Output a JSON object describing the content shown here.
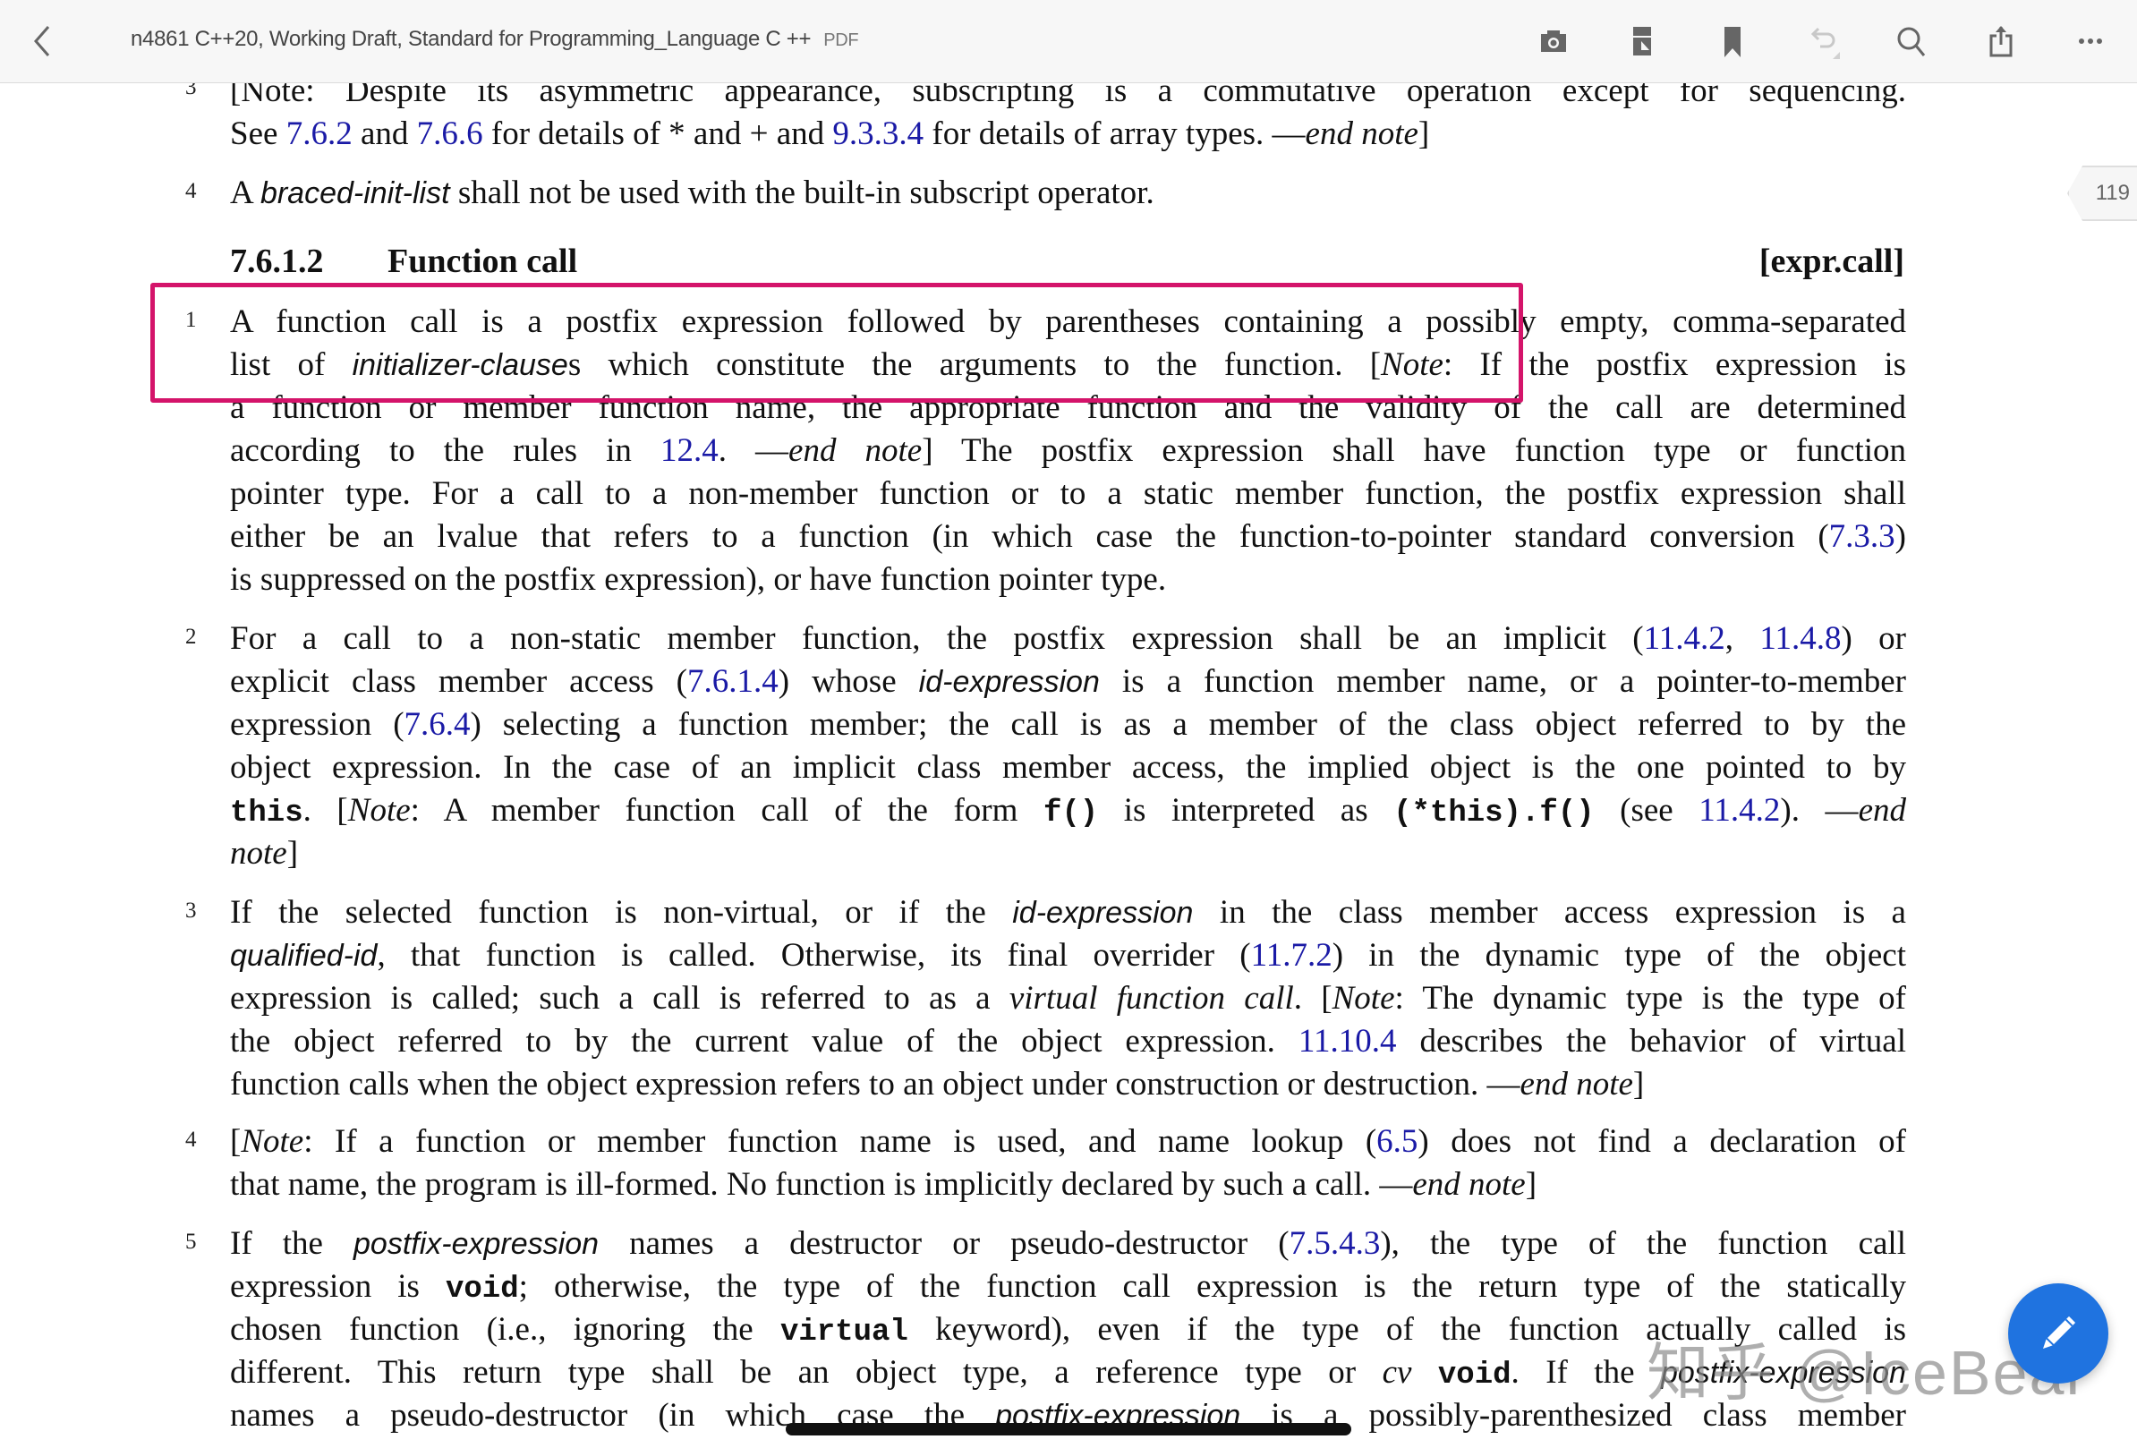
{
  "toolbar": {
    "title": "n4861 C++20, Working Draft, Standard for Programming_Language C ++",
    "doc_type": "PDF",
    "icons": [
      "back-chevron-icon",
      "camera-icon",
      "page-layout-icon",
      "bookmark-icon",
      "undo-icon",
      "search-icon",
      "share-icon",
      "more-icon"
    ]
  },
  "page_badge": "119",
  "section": {
    "number": "7.6.1.2",
    "title": "Function call",
    "tag": "[expr.call]"
  },
  "paragraphs": {
    "p3_prev": {
      "num": "3",
      "l1": "[Note: Despite its asymmetric appearance, subscripting is a commutative operation except for sequencing.",
      "l2a": "See ",
      "l2_link1": "7.6.2",
      "l2b": " and ",
      "l2_link2": "7.6.6",
      "l2c": " for details of * and + and ",
      "l2_link3": "9.3.3.4",
      "l2d": " for details of array types.  —",
      "l2e": "end note",
      "l2f": "]"
    },
    "p4_prev": {
      "num": "4",
      "a": "A ",
      "term": "braced-init-list",
      "b": " shall not be used with the built-in subscript operator."
    },
    "p1": {
      "num": "1",
      "l1": "A function call is a postfix expression followed by parentheses containing a possibly empty, comma-separated",
      "l2a": "list of ",
      "l2_term": "initializer-clause",
      "l2b": "s which constitute the arguments to the function. [",
      "l2_note": "Note",
      "l2c": ": If the postfix expression is",
      "l3": "a function or member function name, the appropriate function and the validity of the call are determined",
      "l4a": "according to the rules in ",
      "l4_link": "12.4",
      "l4b": ".  —",
      "l4_end": "end note",
      "l4c": "]  The postfix expression shall have function type or function",
      "l5": "pointer type. For a call to a non-member function or to a static member function, the postfix expression shall",
      "l6a": "either be an lvalue that refers to a function (in which case the function-to-pointer standard conversion (",
      "l6_link": "7.3.3",
      "l6b": ")",
      "l7": "is suppressed on the postfix expression), or have function pointer type."
    },
    "p2": {
      "num": "2",
      "l1a": "For a call to a non-static member function, the postfix expression shall be an implicit (",
      "l1_link1": "11.4.2",
      "l1b": ", ",
      "l1_link2": "11.4.8",
      "l1c": ") or",
      "l2a": "explicit class member access (",
      "l2_link": "7.6.1.4",
      "l2b": ") whose ",
      "l2_term": "id-expression",
      "l2c": " is a function member name, or a pointer-to-member",
      "l3a": "expression (",
      "l3_link": "7.6.4",
      "l3b": ") selecting a function member; the call is as a member of the class object referred to by the",
      "l4": "object expression. In the case of an implicit class member access, the implied object is the one pointed to by",
      "l5_code1": "this",
      "l5a": ". [",
      "l5_note": "Note",
      "l5b": ": A member function call of the form ",
      "l5_code2": "f()",
      "l5c": " is interpreted as ",
      "l5_code3": "(*this).f()",
      "l5d": " (see ",
      "l5_link": "11.4.2",
      "l5e": ").  —",
      "l5_end": "end",
      "l6_end": "note",
      "l6a": "]"
    },
    "p3": {
      "num": "3",
      "l1a": "If the selected function is non-virtual, or if the ",
      "l1_term": "id-expression",
      "l1b": " in the class member access expression is a",
      "l2_term": "qualified-id",
      "l2a": ", that function is called. Otherwise, its final overrider (",
      "l2_link": "11.7.2",
      "l2b": ") in the dynamic type of the object",
      "l3a": "expression is called; such a call is referred to as a ",
      "l3_term": "virtual function call",
      "l3b": ". [",
      "l3_note": "Note",
      "l3c": ": The dynamic type is the type of",
      "l4a": "the object referred to by the current value of the object expression. ",
      "l4_link": "11.10.4",
      "l4b": " describes the behavior of virtual",
      "l5a": "function calls when the object expression refers to an object under construction or destruction.  —",
      "l5_end": "end note",
      "l5b": "]"
    },
    "p4": {
      "num": "4",
      "l1a": "[",
      "l1_note": "Note",
      "l1b": ": If a function or member function name is used, and name lookup (",
      "l1_link": "6.5",
      "l1c": ") does not find a declaration of",
      "l2a": "that name, the program is ill-formed. No function is implicitly declared by such a call.  —",
      "l2_end": "end note",
      "l2b": "]"
    },
    "p5": {
      "num": "5",
      "l1a": "If the ",
      "l1_term": "postfix-expression",
      "l1b": " names a destructor or pseudo-destructor (",
      "l1_link": "7.5.4.3",
      "l1c": "), the type of the function call",
      "l2a": "expression is ",
      "l2_code": "void",
      "l2b": "; otherwise, the type of the function call expression is the return type of the statically",
      "l3a": "chosen function (i.e., ignoring the ",
      "l3_code": "virtual",
      "l3b": " keyword), even if the type of the function actually called is",
      "l4a": "different. This return type shall be an object type, a reference type or ",
      "l4_cv": "cv",
      "l4_code": "void",
      "l4b": ". If the ",
      "l4_term": "postfix-expression",
      "l5a": "names a pseudo-destructor (in which case the ",
      "l5_term": "postfix-expression",
      "l5b": " is a possibly-parenthesized class member"
    }
  },
  "watermark": "知乎 @IceBear",
  "colors": {
    "highlight": "#d4146a",
    "link": "#1a1aa6",
    "fab": "#1f73e0",
    "toolbar_bg": "#f7f7f7"
  }
}
